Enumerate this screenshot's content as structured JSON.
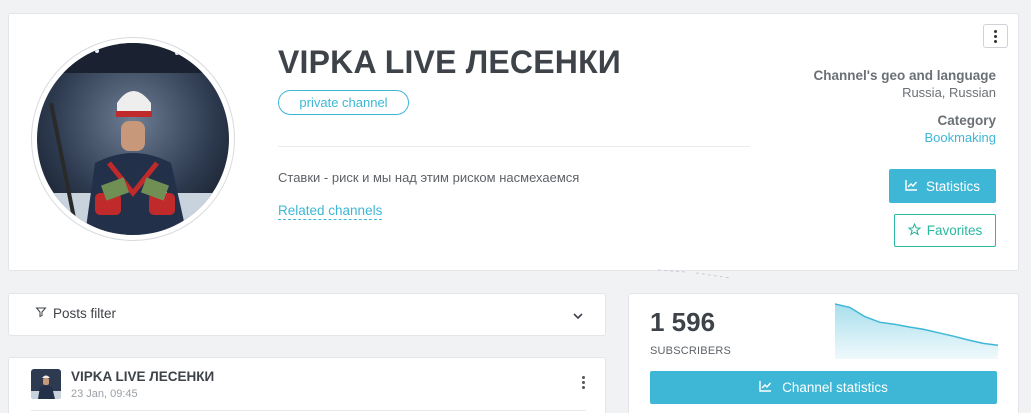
{
  "channel": {
    "title": "VIPKA LIVE ЛЕСЕНКИ",
    "type_badge": "private channel",
    "description": "Ставки - риск и мы над этим риском насмехаемся",
    "related_link": "Related channels"
  },
  "meta": {
    "geo_label": "Channel's geo and language",
    "geo_value": "Russia, Russian",
    "category_label": "Category",
    "category_value": "Bookmaking"
  },
  "actions": {
    "statistics": "Statistics",
    "favorites": "Favorites"
  },
  "filter": {
    "label": "Posts filter"
  },
  "post": {
    "author": "VIPKA LIVE ЛЕСЕНКИ",
    "date": "23 Jan, 09:45"
  },
  "stats": {
    "subscribers": "1 596",
    "subscribers_label": "SUBSCRIBERS",
    "channel_stats_button": "Channel statistics",
    "trend": [
      1.0,
      0.93,
      0.74,
      0.62,
      0.58,
      0.52,
      0.47,
      0.4,
      0.33,
      0.25,
      0.18,
      0.14
    ]
  },
  "colors": {
    "accent": "#3eb7d6",
    "favorite": "#29b8a0"
  },
  "icons": {
    "menu": "kebab-icon",
    "statistics": "chart-line-icon",
    "favorites": "star-icon",
    "filter": "filter-icon",
    "expand": "chevron-down-icon"
  }
}
